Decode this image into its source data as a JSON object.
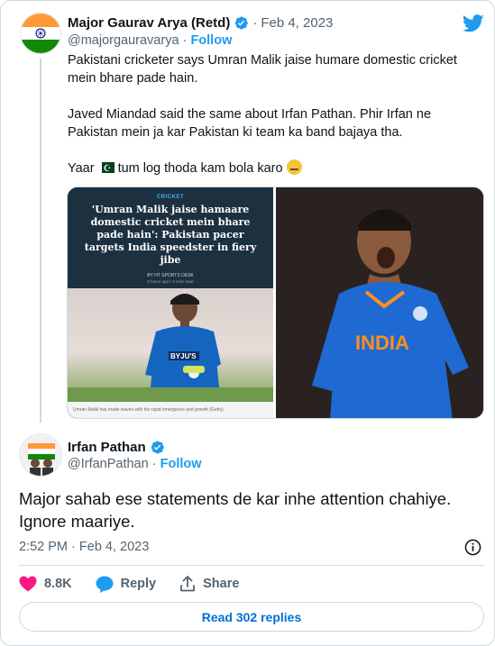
{
  "parent_tweet": {
    "author_name": "Major Gaurav Arya (Retd)",
    "separator": "·",
    "date": "Feb 4, 2023",
    "handle": "@majorgauravarya",
    "handle_separator": "·",
    "follow_label": "Follow",
    "text_line1": "Pakistani cricketer says Umran Malik jaise humare domestic cricket mein bhare pade hain.",
    "text_line2": "Javed Miandad said the same about Irfan Pathan. Phir Irfan ne Pakistan mein ja kar Pakistan ki team ka band bajaya tha.",
    "text_line3": "Yaar",
    "text_line3_end": "tum log thoda kam bola karo",
    "emoji_flag": "pakistan-flag-emoji",
    "emoji_end": "zipper-mouth-emoji",
    "media": {
      "news_category": "CRICKET",
      "news_headline": "'Umran Malik jaise hamaare domestic cricket mein bhare pade hain': Pakistan pacer targets India speedster in fiery jibe",
      "news_byline": "BY HT SPORTS DESK",
      "news_meta": "5 hours ago • 3 mins read",
      "photo_caption": "Umran Malik has made waves with his rapid emergence and growth (Getty)",
      "jersey_text": "INDIA",
      "sponsor_text": "BYJU'S"
    }
  },
  "reply_tweet": {
    "author_name": "Irfan Pathan",
    "handle": "@IrfanPathan",
    "handle_separator": "·",
    "follow_label": "Follow",
    "text": "Major sahab ese statements de kar inhe attention chahiye. Ignore maariye.",
    "time": "2:52 PM",
    "time_separator": "·",
    "date": "Feb 4, 2023"
  },
  "actions": {
    "like_count": "8.8K",
    "reply_label": "Reply",
    "share_label": "Share"
  },
  "read_replies_label": "Read 302 replies",
  "colors": {
    "accent": "#1d9bf0",
    "like": "#f91880",
    "text": "#0f1419",
    "secondary_text": "#536471",
    "border": "#cfd9de"
  }
}
